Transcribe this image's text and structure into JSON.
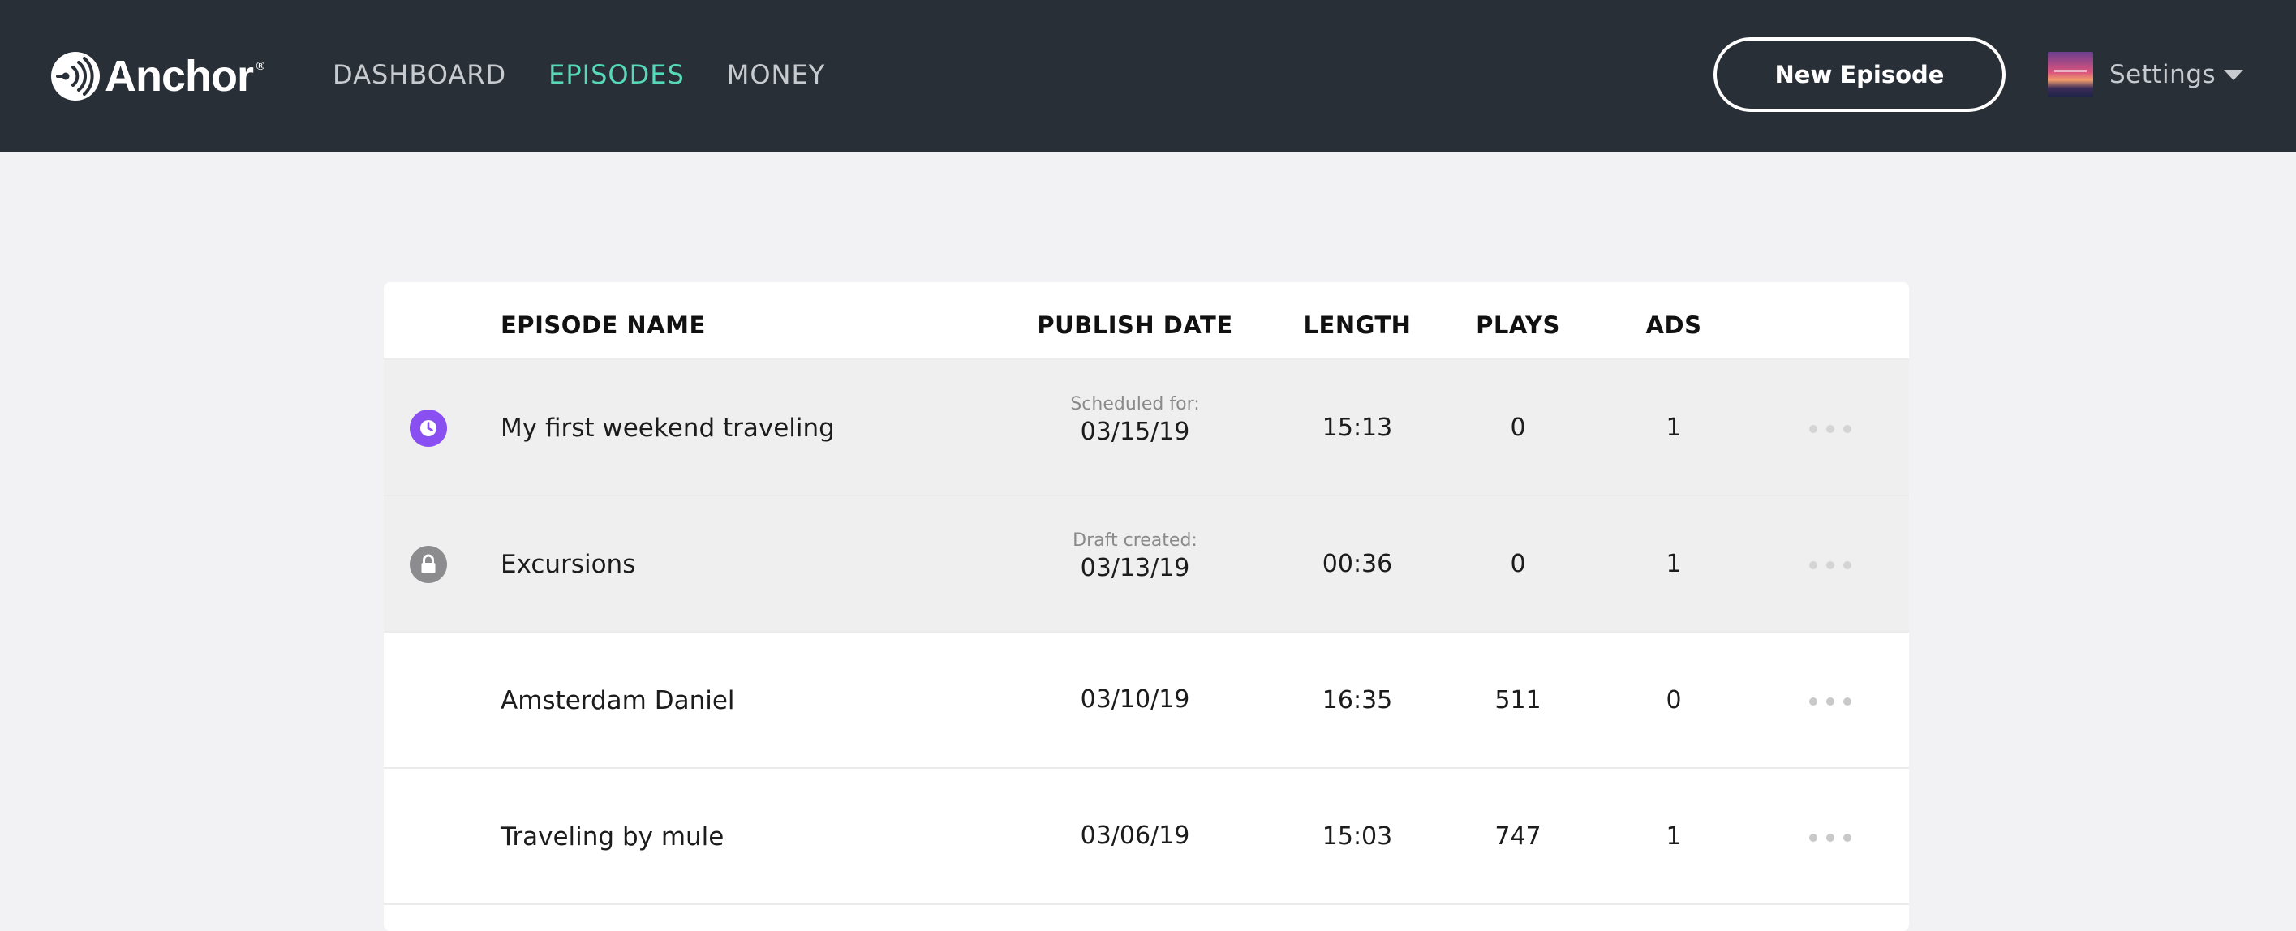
{
  "brand": {
    "name": "Anchor",
    "reg": "®"
  },
  "nav": [
    {
      "label": "DASHBOARD",
      "active": false
    },
    {
      "label": "EPISODES",
      "active": true
    },
    {
      "label": "MONEY",
      "active": false
    }
  ],
  "header": {
    "new_episode_label": "New Episode",
    "settings_label": "Settings"
  },
  "colors": {
    "topbar": "#292f37",
    "nav_active": "#55d9b8",
    "scheduled_icon": "#8a4ff0",
    "draft_icon": "#8c8c8f"
  },
  "table": {
    "columns": [
      "EPISODE NAME",
      "PUBLISH DATE",
      "LENGTH",
      "PLAYS",
      "ADS"
    ],
    "rows": [
      {
        "status_icon": "clock-icon",
        "name": "My first weekend traveling",
        "date_caption": "Scheduled for:",
        "date": "03/15/19",
        "length": "15:13",
        "plays": "0",
        "ads": "1"
      },
      {
        "status_icon": "lock-icon",
        "name": "Excursions",
        "date_caption": "Draft created:",
        "date": "03/13/19",
        "length": "00:36",
        "plays": "0",
        "ads": "1"
      },
      {
        "status_icon": "",
        "name": "Amsterdam Daniel",
        "date_caption": "",
        "date": "03/10/19",
        "length": "16:35",
        "plays": "511",
        "ads": "0"
      },
      {
        "status_icon": "",
        "name": "Traveling by mule",
        "date_caption": "",
        "date": "03/06/19",
        "length": "15:03",
        "plays": "747",
        "ads": "1"
      }
    ]
  }
}
